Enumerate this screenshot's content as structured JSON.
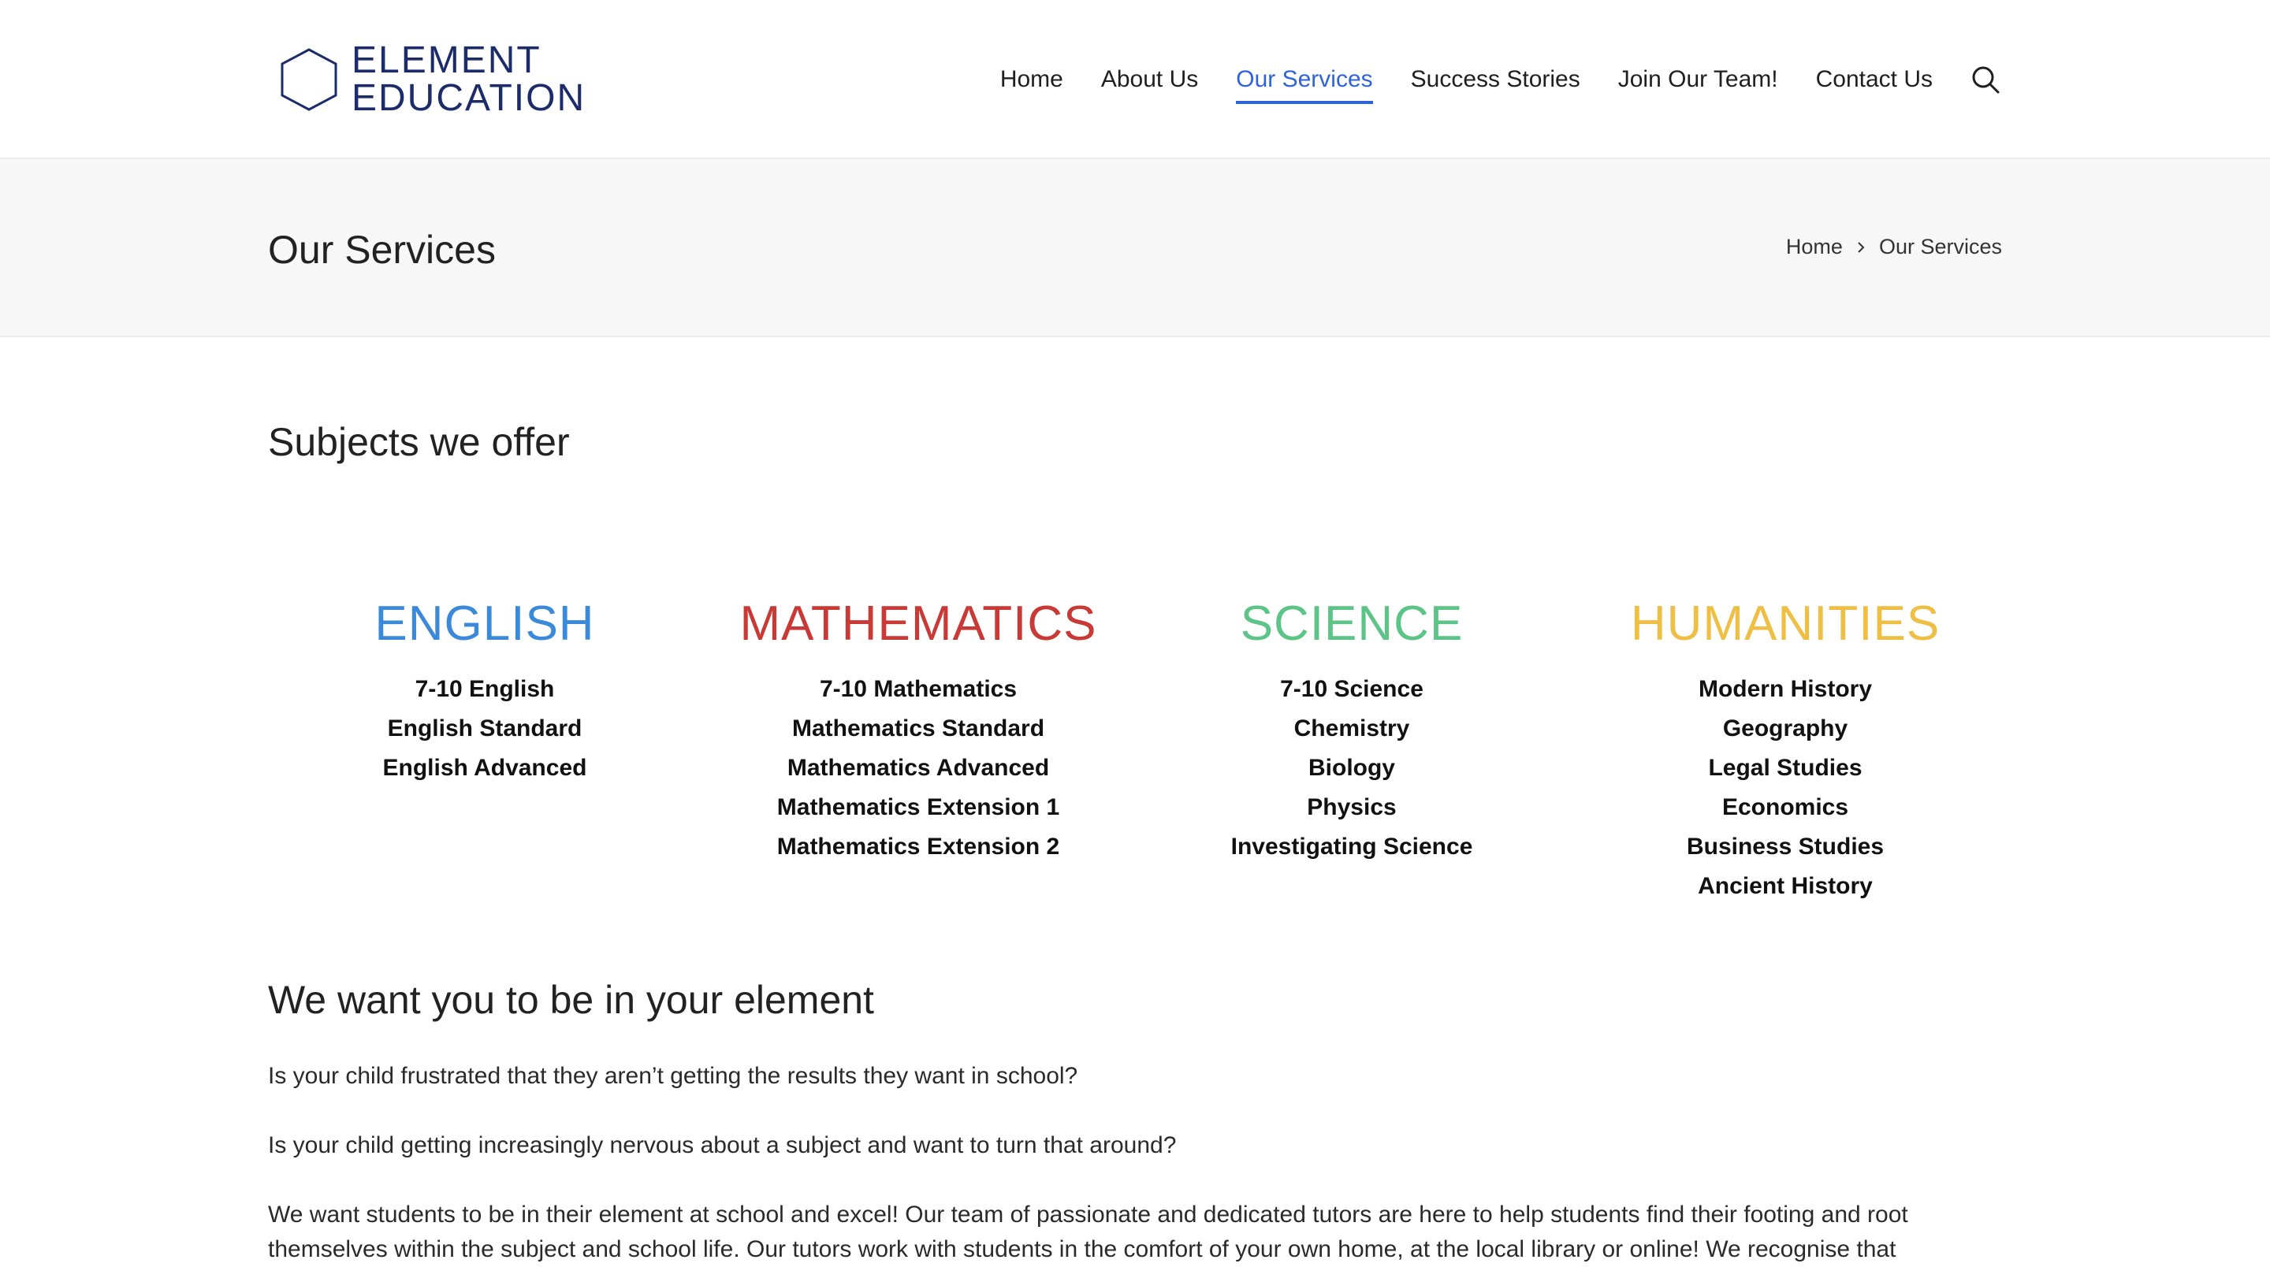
{
  "brand": {
    "line1": "ELEMENT",
    "line2": "EDUCATION",
    "color": "#1c2c6b"
  },
  "nav": {
    "items": [
      {
        "label": "Home",
        "active": false
      },
      {
        "label": "About Us",
        "active": false
      },
      {
        "label": "Our Services",
        "active": true
      },
      {
        "label": "Success Stories",
        "active": false
      },
      {
        "label": "Join Our Team!",
        "active": false
      },
      {
        "label": "Contact Us",
        "active": false
      }
    ],
    "search_icon": "search-icon",
    "active_color": "#2f63d8"
  },
  "title_band": {
    "title": "Our Services",
    "breadcrumb": [
      "Home",
      "Our Services"
    ],
    "separator_icon": "chevron-right-icon"
  },
  "subjects_heading": "Subjects we offer",
  "subjects": [
    {
      "title": "ENGLISH",
      "color": "#3b8ad9",
      "items": [
        "7-10 English",
        "English Standard",
        "English Advanced"
      ]
    },
    {
      "title": "MATHEMATICS",
      "color": "#c93a36",
      "items": [
        "7-10 Mathematics",
        "Mathematics Standard",
        "Mathematics Advanced",
        "Mathematics Extension 1",
        "Mathematics Extension 2"
      ]
    },
    {
      "title": "SCIENCE",
      "color": "#5cc486",
      "items": [
        "7-10 Science",
        "Chemistry",
        "Biology",
        "Physics",
        "Investigating Science"
      ]
    },
    {
      "title": "HUMANITIES",
      "color": "#efbf43",
      "items": [
        "Modern History",
        "Geography",
        "Legal Studies",
        "Economics",
        "Business Studies",
        "Ancient History"
      ]
    }
  ],
  "element_section": {
    "heading": "We want you to be in your element",
    "paragraphs": [
      "Is your child frustrated that they aren’t getting the results they want in school?",
      "Is your child getting increasingly nervous about a subject and want to turn that around?",
      "We want students to be in their element at school and excel! Our team of passionate and dedicated tutors are here to help students find their footing and root themselves within the subject and school life. Our tutors work with students in the comfort of your own home, at the local library or online! We recognise that"
    ]
  }
}
